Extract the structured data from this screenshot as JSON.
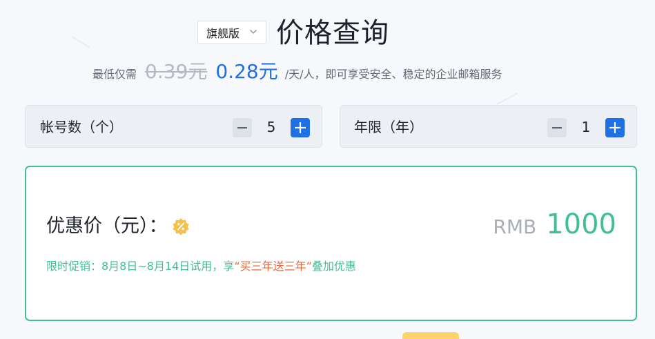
{
  "header": {
    "version_select": {
      "value": "旗舰版",
      "icon": "chevron-down-icon"
    },
    "title": "价格查询"
  },
  "subline": {
    "prefix": "最低仅需",
    "old_price": "0.39元",
    "new_price": "0.28元",
    "suffix": "/天/人，即可享受安全、稳定的企业邮箱服务"
  },
  "accounts_counter": {
    "label": "帐号数（个）",
    "value": "5",
    "minus_icon": "minus-icon",
    "plus_icon": "plus-icon"
  },
  "years_counter": {
    "label": "年限（年）",
    "value": "1",
    "minus_icon": "minus-icon",
    "plus_icon": "plus-icon"
  },
  "price": {
    "label": "优惠价（元）：",
    "badge_icon": "discount-badge-icon",
    "currency": "RMB",
    "amount": "1000",
    "promo_prefix": "限时促销：8月8日~8月14日试用，享",
    "promo_highlight": "“买三年送三年”",
    "promo_suffix": "叠加优惠"
  },
  "colors": {
    "accent_blue": "#1f6fe5",
    "accent_green": "#3fbf93",
    "promo_orange": "#f0653a",
    "badge_yellow": "#f7c04a",
    "background": "#f6f8fb"
  }
}
